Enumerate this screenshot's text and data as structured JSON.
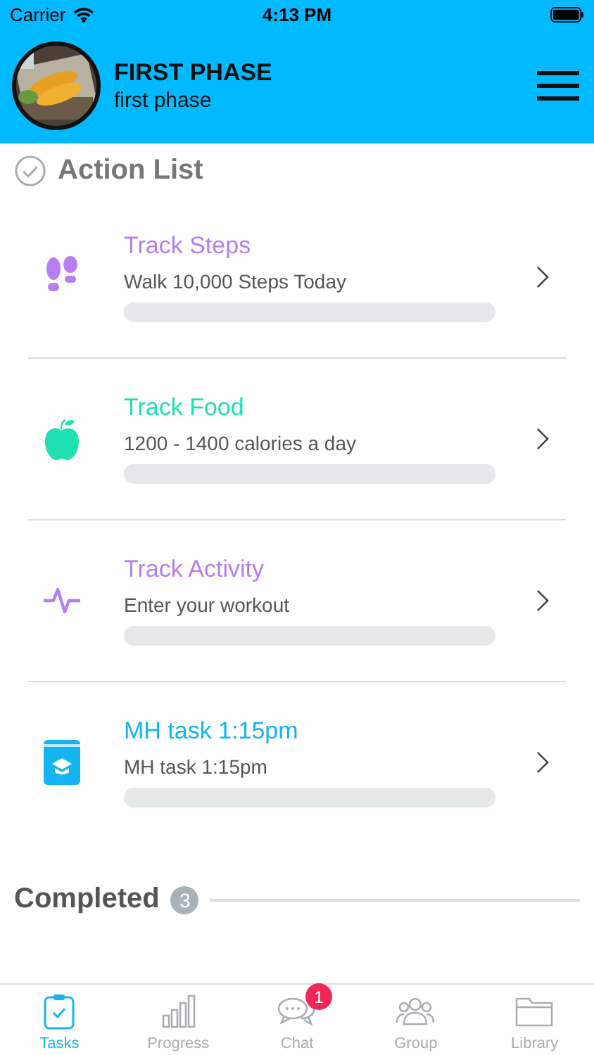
{
  "status_bar": {
    "carrier": "Carrier",
    "time": "4:13 PM"
  },
  "header": {
    "title": "FIRST PHASE",
    "subtitle": "first phase"
  },
  "action_list": {
    "title": "Action List",
    "items": [
      {
        "kind": "steps",
        "title": "Track Steps",
        "subtitle": "Walk 10,000 Steps Today",
        "color": "#b57ff0",
        "level": 0
      },
      {
        "kind": "food",
        "title": "Track Food",
        "subtitle": "1200 - 1400 calories a day",
        "color": "#1fe0b0",
        "level": 0
      },
      {
        "kind": "activity",
        "title": "Track Activity",
        "subtitle": "Enter your workout",
        "color": "#b57ff0",
        "level": 0
      },
      {
        "kind": "book",
        "title": "MH task 1:15pm",
        "subtitle": "MH task 1:15pm",
        "color": "#14b4f0",
        "level": 0
      }
    ]
  },
  "completed": {
    "title": "Completed",
    "count": "3"
  },
  "tab_bar": [
    {
      "kind": "tasks",
      "label": "Tasks",
      "selected": true
    },
    {
      "kind": "progress",
      "label": "Progress",
      "selected": false
    },
    {
      "kind": "chat",
      "label": "Chat",
      "selected": false,
      "badge": "1"
    },
    {
      "kind": "group",
      "label": "Group",
      "selected": false
    },
    {
      "kind": "library",
      "label": "Library",
      "selected": false
    }
  ]
}
